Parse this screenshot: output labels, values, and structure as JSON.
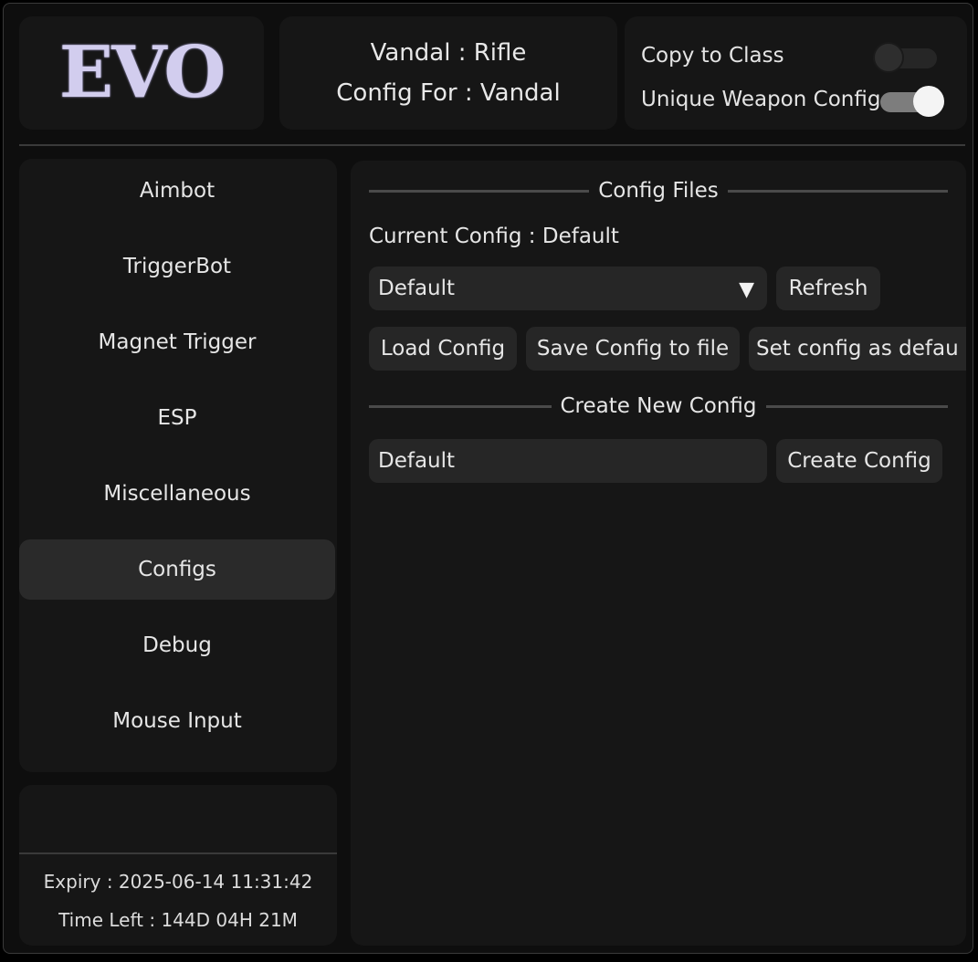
{
  "header": {
    "logo_text": "EVO",
    "weapon_line": "Vandal : Rifle",
    "config_for_line": "Config For : Vandal",
    "copy_to_class": {
      "label": "Copy to Class",
      "enabled": false
    },
    "unique_weapon_config": {
      "label": "Unique Weapon Config",
      "enabled": true
    }
  },
  "sidebar": {
    "items": [
      {
        "label": "Aimbot",
        "active": false
      },
      {
        "label": "TriggerBot",
        "active": false
      },
      {
        "label": "Magnet Trigger",
        "active": false
      },
      {
        "label": "ESP",
        "active": false
      },
      {
        "label": "Miscellaneous",
        "active": false
      },
      {
        "label": "Configs",
        "active": true
      },
      {
        "label": "Debug",
        "active": false
      },
      {
        "label": "Mouse Input",
        "active": false
      }
    ]
  },
  "license": {
    "expiry": "Expiry : 2025-06-14 11:31:42",
    "time_left": "Time Left : 144D 04H 21M"
  },
  "configs": {
    "files_header": "Config Files",
    "current_config": "Current Config : Default",
    "dropdown_value": "Default",
    "refresh_label": "Refresh",
    "load_label": "Load Config",
    "save_label": "Save Config to file",
    "set_default_label": "Set config as defau",
    "create_header": "Create New Config",
    "new_name_value": "Default",
    "create_label": "Create Config"
  },
  "colors": {
    "window_bg": "#0e0e0e",
    "panel_bg": "#161616",
    "control_bg": "#262626",
    "active_nav_bg": "#2a2a2a",
    "logo": "#d2cdee"
  }
}
